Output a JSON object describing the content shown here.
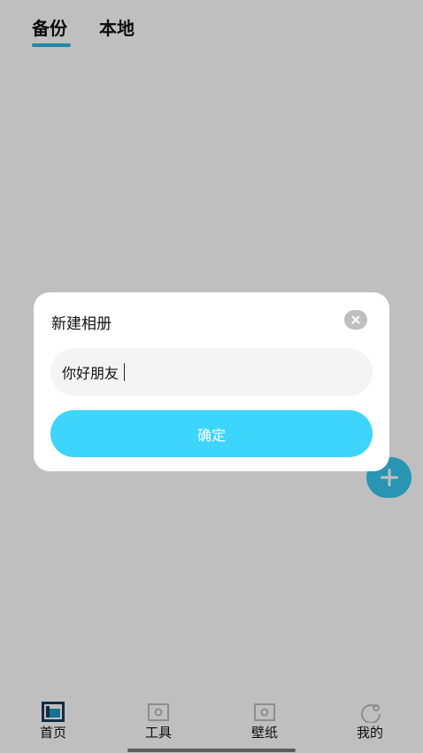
{
  "tabs": [
    {
      "label": "备份",
      "active": true
    },
    {
      "label": "本地",
      "active": false
    }
  ],
  "bottom_nav": {
    "items": [
      {
        "label": "首页",
        "icon": "home-icon",
        "active": true
      },
      {
        "label": "工具",
        "icon": "tools-icon",
        "active": false
      },
      {
        "label": "壁纸",
        "icon": "wallpaper-icon",
        "active": false
      },
      {
        "label": "我的",
        "icon": "profile-icon",
        "active": false
      }
    ]
  },
  "fab": {
    "icon": "plus-icon"
  },
  "dialog": {
    "title": "新建相册",
    "input_value": "你好朋友",
    "confirm_label": "确定",
    "close_icon": "close-icon"
  },
  "colors": {
    "accent": "#3dd5fb",
    "fab": "#36c8ef",
    "tab_indicator": "#2fb4d8",
    "overlay": "rgba(0,0,0,0.25)"
  }
}
